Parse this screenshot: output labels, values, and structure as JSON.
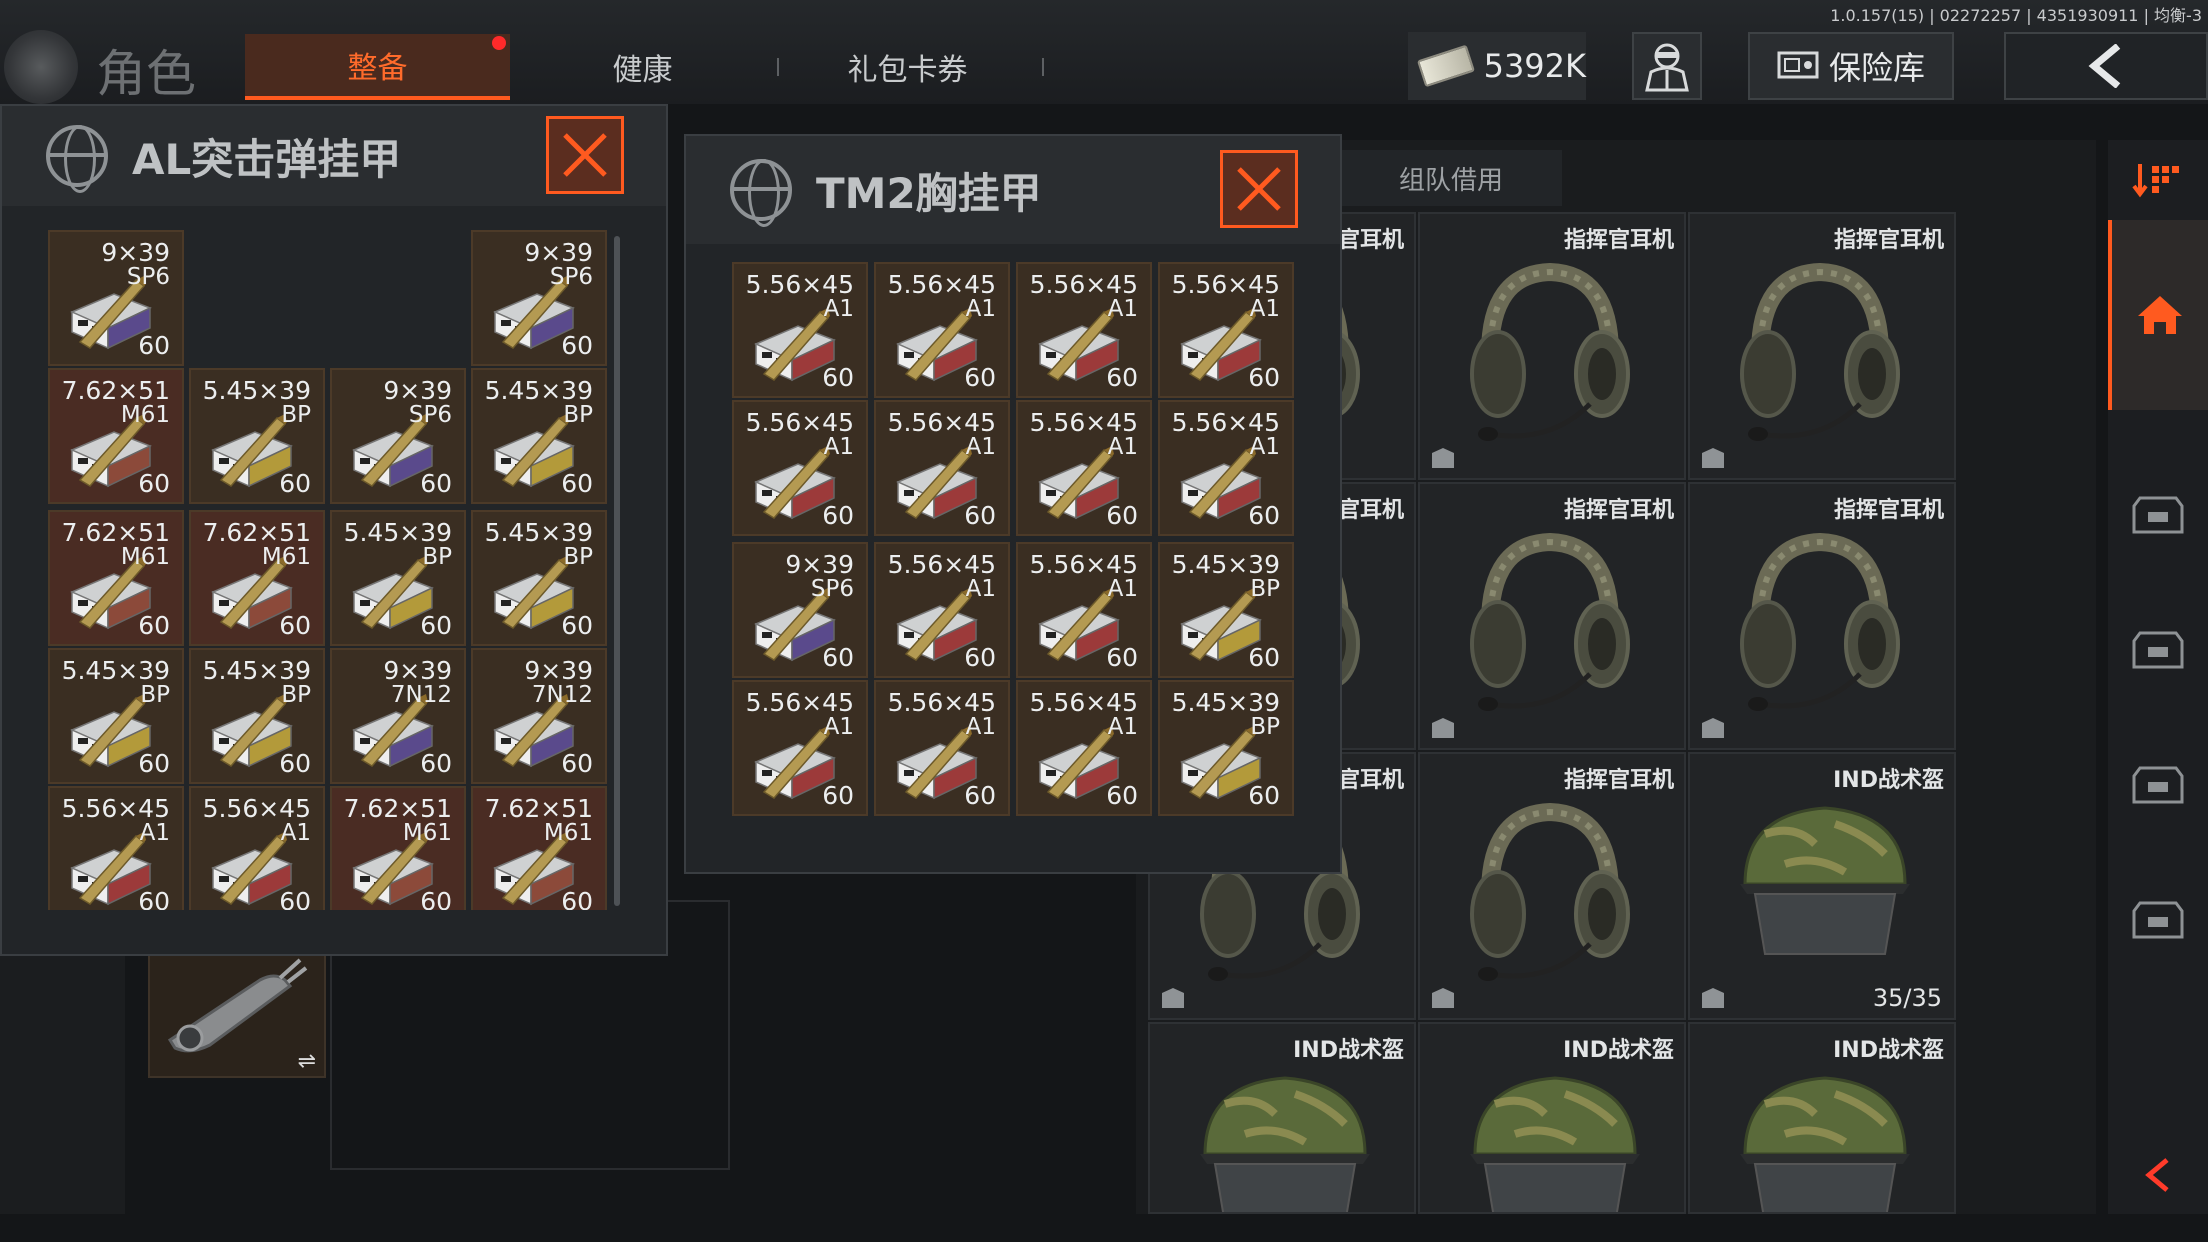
{
  "version": "1.0.157(15) | 02272257 | 4351930911 | 均衡-3",
  "header": {
    "title": "角色",
    "tabs": [
      {
        "label": "整备",
        "active": true,
        "badge": true
      },
      {
        "label": "健康",
        "active": false
      },
      {
        "label": "礼包卡券",
        "active": false
      }
    ],
    "money": "5392K",
    "vault_label": "保险库"
  },
  "borrow_tab": "组队借用",
  "panel_left": {
    "title": "AL突击弹挂甲",
    "ammo": [
      {
        "cal": "9×39",
        "type": "SP6",
        "count": "60",
        "tone": "y",
        "tint": "#5a4a8c"
      },
      {
        "cal": "9×39",
        "type": "SP6",
        "count": "60",
        "tone": "y",
        "tint": "#5a4a8c"
      },
      {
        "cal": "7.62×51",
        "type": "M61",
        "count": "60",
        "tone": "r",
        "tint": "#8c4a3a"
      },
      {
        "cal": "5.45×39",
        "type": "BP",
        "count": "60",
        "tone": "y",
        "tint": "#b39a3a"
      },
      {
        "cal": "9×39",
        "type": "SP6",
        "count": "60",
        "tone": "y",
        "tint": "#5a4a8c"
      },
      {
        "cal": "5.45×39",
        "type": "BP",
        "count": "60",
        "tone": "y",
        "tint": "#b39a3a"
      },
      {
        "cal": "7.62×51",
        "type": "M61",
        "count": "60",
        "tone": "r",
        "tint": "#8c4a3a"
      },
      {
        "cal": "7.62×51",
        "type": "M61",
        "count": "60",
        "tone": "r",
        "tint": "#8c4a3a"
      },
      {
        "cal": "5.45×39",
        "type": "BP",
        "count": "60",
        "tone": "y",
        "tint": "#b39a3a"
      },
      {
        "cal": "5.45×39",
        "type": "BP",
        "count": "60",
        "tone": "y",
        "tint": "#b39a3a"
      },
      {
        "cal": "5.45×39",
        "type": "BP",
        "count": "60",
        "tone": "y",
        "tint": "#b39a3a"
      },
      {
        "cal": "5.45×39",
        "type": "BP",
        "count": "60",
        "tone": "y",
        "tint": "#b39a3a"
      },
      {
        "cal": "9×39",
        "type": "7N12",
        "count": "60",
        "tone": "y",
        "tint": "#5a4a8c"
      },
      {
        "cal": "9×39",
        "type": "7N12",
        "count": "60",
        "tone": "y",
        "tint": "#5a4a8c"
      },
      {
        "cal": "5.56×45",
        "type": "A1",
        "count": "60",
        "tone": "y",
        "tint": "#9c3a3a"
      },
      {
        "cal": "5.56×45",
        "type": "A1",
        "count": "60",
        "tone": "y",
        "tint": "#9c3a3a"
      },
      {
        "cal": "7.62×51",
        "type": "M61",
        "count": "60",
        "tone": "r",
        "tint": "#8c4a3a"
      },
      {
        "cal": "7.62×51",
        "type": "M61",
        "count": "60",
        "tone": "r",
        "tint": "#8c4a3a"
      }
    ]
  },
  "panel_right": {
    "title": "TM2胸挂甲",
    "ammo": [
      {
        "cal": "5.56×45",
        "type": "A1",
        "count": "60",
        "tone": "y",
        "tint": "#9c3a3a"
      },
      {
        "cal": "5.56×45",
        "type": "A1",
        "count": "60",
        "tone": "y",
        "tint": "#9c3a3a"
      },
      {
        "cal": "5.56×45",
        "type": "A1",
        "count": "60",
        "tone": "y",
        "tint": "#9c3a3a"
      },
      {
        "cal": "5.56×45",
        "type": "A1",
        "count": "60",
        "tone": "y",
        "tint": "#9c3a3a"
      },
      {
        "cal": "5.56×45",
        "type": "A1",
        "count": "60",
        "tone": "y",
        "tint": "#9c3a3a"
      },
      {
        "cal": "5.56×45",
        "type": "A1",
        "count": "60",
        "tone": "y",
        "tint": "#9c3a3a"
      },
      {
        "cal": "5.56×45",
        "type": "A1",
        "count": "60",
        "tone": "y",
        "tint": "#9c3a3a"
      },
      {
        "cal": "5.56×45",
        "type": "A1",
        "count": "60",
        "tone": "y",
        "tint": "#9c3a3a"
      },
      {
        "cal": "9×39",
        "type": "SP6",
        "count": "60",
        "tone": "y",
        "tint": "#5a4a8c"
      },
      {
        "cal": "5.56×45",
        "type": "A1",
        "count": "60",
        "tone": "y",
        "tint": "#9c3a3a"
      },
      {
        "cal": "5.56×45",
        "type": "A1",
        "count": "60",
        "tone": "y",
        "tint": "#9c3a3a"
      },
      {
        "cal": "5.45×39",
        "type": "BP",
        "count": "60",
        "tone": "y",
        "tint": "#b39a3a"
      },
      {
        "cal": "5.56×45",
        "type": "A1",
        "count": "60",
        "tone": "y",
        "tint": "#9c3a3a"
      },
      {
        "cal": "5.56×45",
        "type": "A1",
        "count": "60",
        "tone": "y",
        "tint": "#9c3a3a"
      },
      {
        "cal": "5.56×45",
        "type": "A1",
        "count": "60",
        "tone": "y",
        "tint": "#9c3a3a"
      },
      {
        "cal": "5.45×39",
        "type": "BP",
        "count": "60",
        "tone": "y",
        "tint": "#b39a3a"
      }
    ]
  },
  "equipment": [
    {
      "label": "指挥官耳机",
      "kind": "headset",
      "count": ""
    },
    {
      "label": "指挥官耳机",
      "kind": "headset",
      "count": ""
    },
    {
      "label": "指挥官耳机",
      "kind": "headset",
      "count": ""
    },
    {
      "label": "指挥官耳机",
      "kind": "headset",
      "count": ""
    },
    {
      "label": "指挥官耳机",
      "kind": "headset",
      "count": ""
    },
    {
      "label": "指挥官耳机",
      "kind": "headset",
      "count": ""
    },
    {
      "label": "指挥官耳机",
      "kind": "headset",
      "count": ""
    },
    {
      "label": "指挥官耳机",
      "kind": "headset",
      "count": ""
    },
    {
      "label": "IND战术盔",
      "kind": "helmet",
      "count": "35/35"
    },
    {
      "label": "IND战术盔",
      "kind": "helmet",
      "count": ""
    },
    {
      "label": "IND战术盔",
      "kind": "helmet",
      "count": ""
    },
    {
      "label": "IND战术盔",
      "kind": "helmet",
      "count": ""
    }
  ],
  "colors": {
    "accent": "#ff5a1f",
    "badge": "#ff2a2a"
  }
}
